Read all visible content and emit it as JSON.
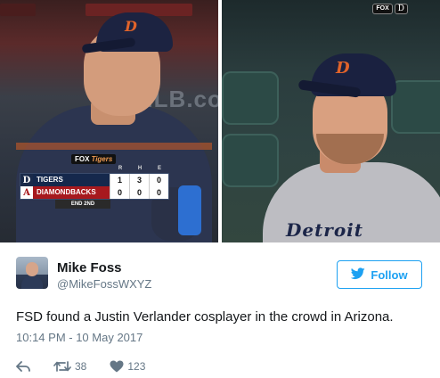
{
  "photos": {
    "left": {
      "dugout_sign_text": "MLB.com",
      "wall_text": "MLB.co",
      "cap_logo": "D",
      "scorebug": {
        "network": "FOX",
        "network_brand": "Tigers",
        "columns": [
          "R",
          "H",
          "E"
        ],
        "teams": [
          {
            "abbr_logo": "D",
            "name": "TIGERS",
            "runs": "1",
            "hits": "3",
            "errors": "0"
          },
          {
            "abbr_logo": "A",
            "name": "DIAMONDBACKS",
            "runs": "0",
            "hits": "0",
            "errors": "0"
          }
        ],
        "inning": "END 2ND"
      }
    },
    "right": {
      "network_bug": "FOX",
      "team_bug": "D",
      "cap_logo": "D",
      "jersey_text": "Detroit"
    }
  },
  "tweet": {
    "display_name": "Mike Foss",
    "handle": "@MikeFossWXYZ",
    "follow_label": "Follow",
    "text": "FSD found a Justin Verlander cosplayer in the crowd in Arizona.",
    "timestamp": "10:14 PM - 10 May 2017",
    "actions": {
      "retweets": "38",
      "likes": "123"
    },
    "colors": {
      "accent": "#1da1f2",
      "muted": "#657786",
      "text": "#14171a"
    }
  }
}
